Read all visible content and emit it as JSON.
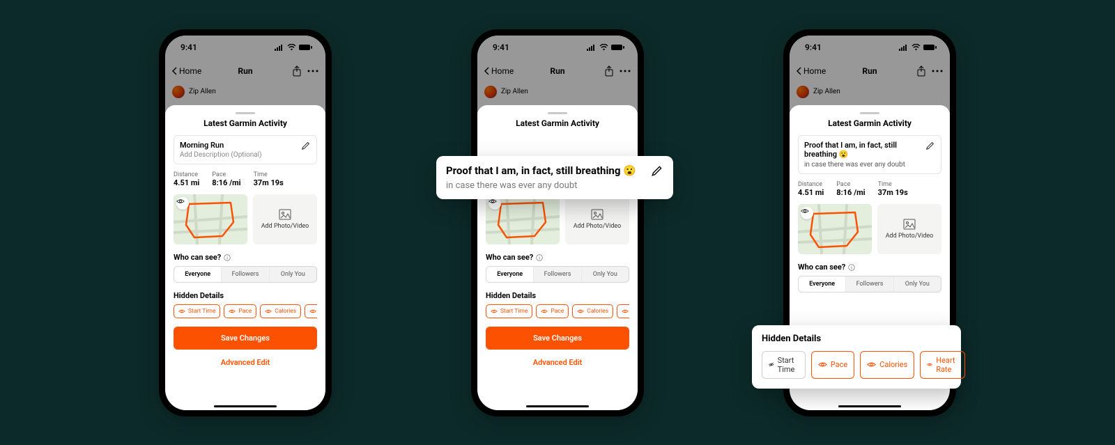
{
  "status": {
    "time": "9:41"
  },
  "nav": {
    "back": "Home",
    "title": "Run"
  },
  "user": {
    "name": "Zip Allen"
  },
  "sheet": {
    "header": "Latest Garmin Activity",
    "edited_title": "Proof that I am, in fact, still breathing 😮",
    "edited_desc": "in case there was ever any doubt",
    "default_title": "Morning Run",
    "default_desc": "Add Description (Optional)",
    "stats": {
      "distance_label": "Distance",
      "distance_value": "4.51 mi",
      "pace_label": "Pace",
      "pace_value": "8:16 /mi",
      "time_label": "Time",
      "time_value": "37m 19s"
    },
    "add_media": "Add Photo/Video",
    "visibility": {
      "header": "Who can see?",
      "options": [
        "Everyone",
        "Followers",
        "Only You"
      ],
      "selected": "Everyone"
    },
    "hidden": {
      "header": "Hidden Details",
      "items": [
        "Start Time",
        "Pace",
        "Calories",
        "Heart Rate"
      ]
    },
    "save": "Save Changes",
    "advanced": "Advanced Edit"
  },
  "callouts": {
    "hidden_header": "Hidden Details",
    "hidden_items": [
      "Start Time",
      "Pace",
      "Calories",
      "Heart Rate"
    ]
  },
  "colors": {
    "accent": "#fc5200",
    "bg": "#0c2a29"
  }
}
